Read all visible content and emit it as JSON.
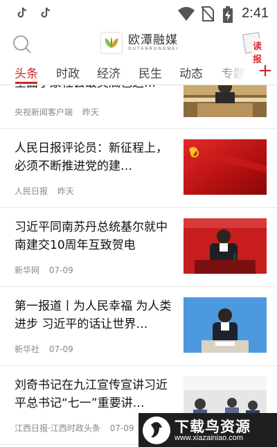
{
  "status_bar": {
    "time": "2:41"
  },
  "header": {
    "app_name_cn": "欧潭融媒",
    "app_name_en": "OUTANRONGMEI",
    "read_paper_label": "读报"
  },
  "tabs": [
    {
      "label": "头条",
      "active": true
    },
    {
      "label": "时政",
      "active": false
    },
    {
      "label": "经济",
      "active": false
    },
    {
      "label": "民生",
      "active": false
    },
    {
      "label": "动态",
      "active": false
    },
    {
      "label": "专题",
      "active": false
    }
  ],
  "add_channel": "+",
  "accent_color": "#c62828",
  "news": [
    {
      "title": "全面小康社会最美底色这…",
      "source": "央视新闻客户端",
      "time": "昨天"
    },
    {
      "title": "人民日报评论员：新征程上，必须不断推进党的建…",
      "source": "人民日报",
      "time": "昨天"
    },
    {
      "title": "习近平同南苏丹总统基尔就中南建交10周年互致贺电",
      "source": "新华网",
      "time": "07-09"
    },
    {
      "title": "第一报道丨为人民幸福 为人类进步 习近平的话让世界…",
      "source": "新华社",
      "time": "07-09"
    },
    {
      "title": "刘奇书记在九江宣传宣讲习近平总书记“七一”重要讲…",
      "source": "江西日报·江西时政头条",
      "time": "07-09"
    }
  ],
  "banner": {
    "title": "下载鸟资源",
    "url": "www.xiazainiao.com"
  }
}
